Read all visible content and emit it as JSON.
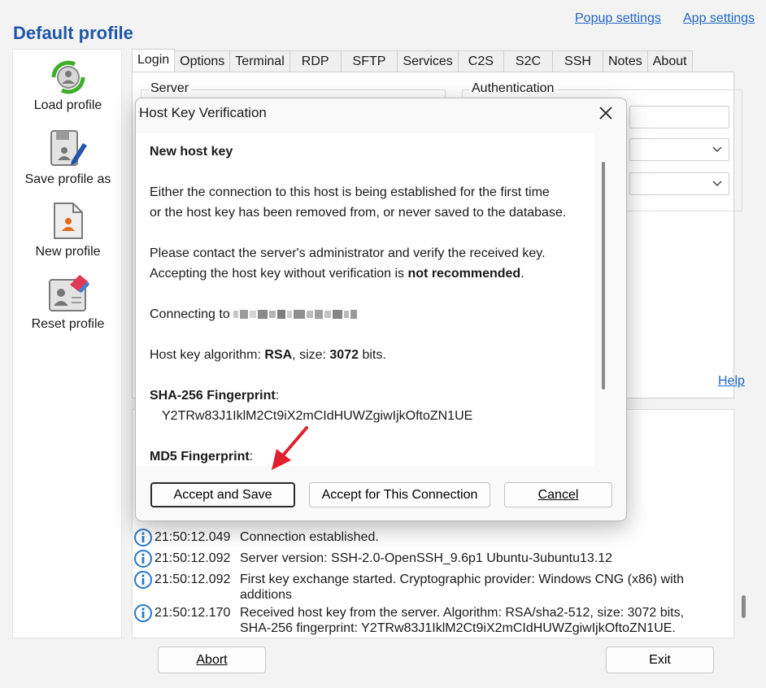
{
  "profile_title": "Default profile",
  "top_links": {
    "popup_settings": "Popup settings",
    "app_settings": "App settings"
  },
  "sidebar": {
    "items": [
      {
        "label": "Load profile",
        "icon": "load-profile-icon"
      },
      {
        "label": "Save profile as",
        "icon": "save-profile-icon"
      },
      {
        "label": "New profile",
        "icon": "new-profile-icon"
      },
      {
        "label": "Reset profile",
        "icon": "reset-profile-icon"
      }
    ]
  },
  "tabs": [
    "Login",
    "Options",
    "Terminal",
    "RDP",
    "SFTP",
    "Services",
    "C2S",
    "S2C",
    "SSH",
    "Notes",
    "About"
  ],
  "active_tab": "Login",
  "login_panel": {
    "server_group": "Server",
    "auth_group": "Authentication",
    "help": "Help"
  },
  "log": [
    {
      "time": "21:50:12.049",
      "message": "Connection established."
    },
    {
      "time": "21:50:12.092",
      "message": "Server version: SSH-2.0-OpenSSH_9.6p1 Ubuntu-3ubuntu13.12"
    },
    {
      "time": "21:50:12.092",
      "message": "First key exchange started. Cryptographic provider: Windows CNG (x86) with additions"
    },
    {
      "time": "21:50:12.170",
      "message": "Received host key from the server. Algorithm: RSA/sha2-512, size: 3072 bits, SHA-256 fingerprint: Y2TRw83J1IklM2Ct9iX2mCIdHUWZgiwIjkOftoZN1UE."
    }
  ],
  "buttons": {
    "abort": "Abort",
    "exit": "Exit"
  },
  "dialog": {
    "title": "Host Key Verification",
    "heading": "New host key",
    "intro_line1": "Either the connection to this host is being established for the first time",
    "intro_line2": "or the host key has been removed from, or never saved to the database.",
    "contact_line1": "Please contact the server's administrator and verify the received key.",
    "contact_line2_prefix": "Accepting the host key without verification is ",
    "contact_line2_bold": "not recommended",
    "contact_line2_suffix": ".",
    "connecting_label": "Connecting to ",
    "algo_prefix": "Host key algorithm: ",
    "algo_value": "RSA",
    "size_prefix": ", size: ",
    "size_value": "3072",
    "size_suffix": " bits.",
    "sha_heading": "SHA-256 Fingerprint",
    "sha_value": "Y2TRw83J1IklM2Ct9iX2mCIdHUWZgiwIjkOftoZN1UE",
    "md5_heading": "MD5 Fingerprint",
    "colon": ":",
    "buttons": {
      "accept_save": "Accept and Save",
      "accept_connection": "Accept for This Connection",
      "cancel": "Cancel"
    }
  },
  "colors": {
    "accent": "#1f56a8",
    "link": "#1f66c8",
    "annotation_arrow": "#e0202e",
    "info_icon": "#2a78c8"
  }
}
